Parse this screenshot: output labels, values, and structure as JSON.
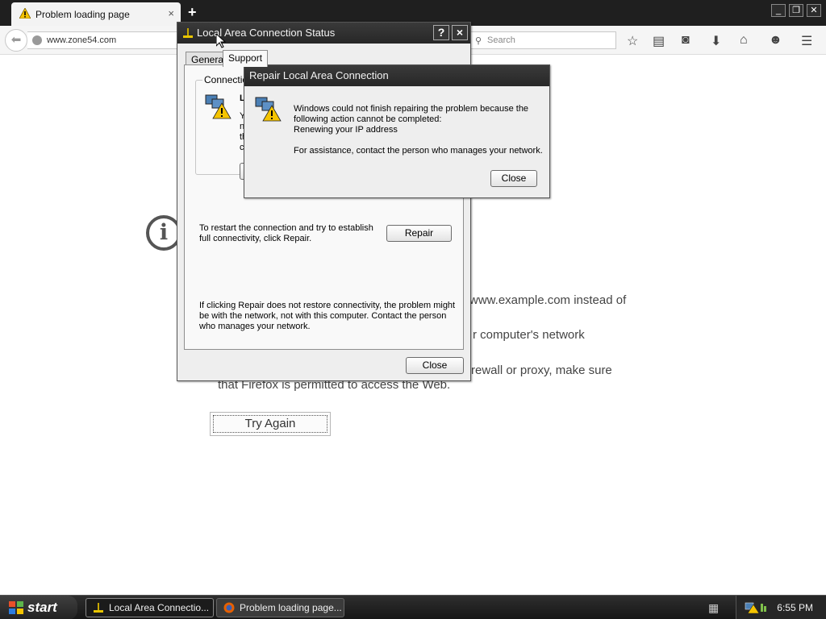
{
  "browser": {
    "tab_title": "Problem loading page",
    "tab_close": "×",
    "new_tab": "+",
    "url": "www.zone54.com",
    "search_placeholder": "Search"
  },
  "page": {
    "line1": "www.example.com instead of",
    "line2": "r computer's network",
    "line3": "rewall or proxy, make sure",
    "line4": "that Firefox is permitted to access the Web.",
    "try_again": "Try Again"
  },
  "status_window": {
    "title": "Local Area Connection Status",
    "help_btn": "?",
    "close_btn": "×",
    "tabs": [
      "General",
      "Support"
    ],
    "group_label": "Connection",
    "partial_letter": "L",
    "partial_lines": [
      "Y",
      "n",
      "th",
      "c"
    ],
    "repair_text": "To restart the connection and try to establish full connectivity, click Repair.",
    "repair_button": "Repair",
    "help_text": "If clicking Repair does not restore connectivity, the problem might be with the network, not with this computer. Contact the person who manages your network.",
    "close_button": "Close"
  },
  "repair_popup": {
    "title": "Repair Local Area Connection",
    "line1": "Windows could not finish repairing the problem because the",
    "line2": "following action cannot be completed:",
    "line3": "Renewing your IP address",
    "line4": "For assistance, contact the person who manages your network.",
    "close_button": "Close"
  },
  "taskbar": {
    "start_label": "start",
    "items": [
      "Local Area Connectio...",
      "Problem loading page..."
    ],
    "clock": "6:55 PM"
  },
  "colors": {
    "title_bar": "#2b2b2b",
    "warning": "#f5c400"
  }
}
